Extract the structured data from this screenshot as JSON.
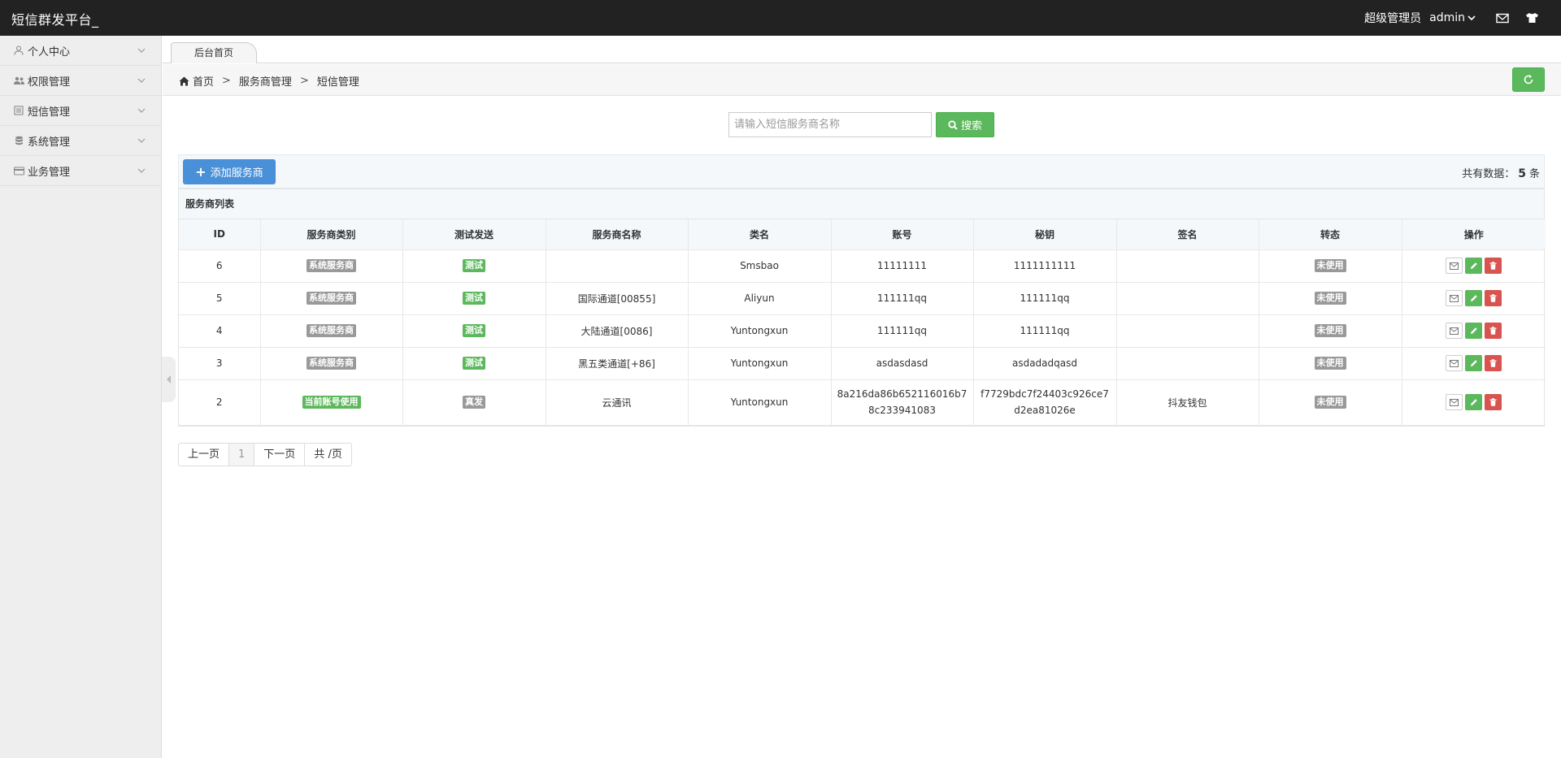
{
  "header": {
    "brand": "短信群发平台_",
    "role": "超级管理员",
    "user": "admin"
  },
  "sidebar": {
    "items": [
      {
        "label": "个人中心",
        "icon": "user-icon"
      },
      {
        "label": "权限管理",
        "icon": "users-icon"
      },
      {
        "label": "短信管理",
        "icon": "book-icon"
      },
      {
        "label": "系统管理",
        "icon": "database-icon"
      },
      {
        "label": "业务管理",
        "icon": "card-icon"
      }
    ]
  },
  "tabs": [
    {
      "label": "后台首页"
    }
  ],
  "breadcrumb": {
    "home": "首页",
    "level1": "服务商管理",
    "level2": "短信管理",
    "sep": ">"
  },
  "search": {
    "placeholder": "请输入短信服务商名称",
    "button": "搜索"
  },
  "toolbar": {
    "add": "添加服务商",
    "total_prefix": "共有数据：",
    "total_count": "5",
    "total_suffix": "条"
  },
  "table": {
    "title": "服务商列表",
    "columns": [
      "ID",
      "服务商类别",
      "测试发送",
      "服务商名称",
      "类名",
      "账号",
      "秘钥",
      "签名",
      "转态",
      "操作"
    ],
    "rows": [
      {
        "id": "6",
        "category": "系统服务商",
        "category_color": "gray",
        "send": "测试",
        "send_color": "green",
        "name": "",
        "class": "Smsbao",
        "account": "11111111",
        "secret": "1111111111",
        "sign": "",
        "status": "未使用"
      },
      {
        "id": "5",
        "category": "系统服务商",
        "category_color": "gray",
        "send": "测试",
        "send_color": "green",
        "name": "国际通道[00855]",
        "class": "Aliyun",
        "account": "111111qq",
        "secret": "111111qq",
        "sign": "",
        "status": "未使用"
      },
      {
        "id": "4",
        "category": "系统服务商",
        "category_color": "gray",
        "send": "测试",
        "send_color": "green",
        "name": "大陆通道[0086]",
        "class": "Yuntongxun",
        "account": "111111qq",
        "secret": "111111qq",
        "sign": "",
        "status": "未使用"
      },
      {
        "id": "3",
        "category": "系统服务商",
        "category_color": "gray",
        "send": "测试",
        "send_color": "green",
        "name": "黑五类通道[+86]",
        "class": "Yuntongxun",
        "account": "asdasdasd",
        "secret": "asdadadqasd",
        "sign": "",
        "status": "未使用"
      },
      {
        "id": "2",
        "category": "当前账号使用",
        "category_color": "green",
        "send": "真发",
        "send_color": "gray",
        "name": "云通讯",
        "class": "Yuntongxun",
        "account": "8a216da86b652116016b78c233941083",
        "secret": "f7729bdc7f24403c926ce7d2ea81026e",
        "sign": "抖友钱包",
        "status": "未使用"
      }
    ]
  },
  "pager": {
    "prev": "上一页",
    "current": "1",
    "next": "下一页",
    "total": "共 /页"
  },
  "colors": {
    "header_bg": "#222222",
    "sidebar_bg": "#eeeeee",
    "success": "#5cb85c",
    "primary": "#4a90d9",
    "danger": "#d9534f",
    "label_gray": "#999999"
  }
}
